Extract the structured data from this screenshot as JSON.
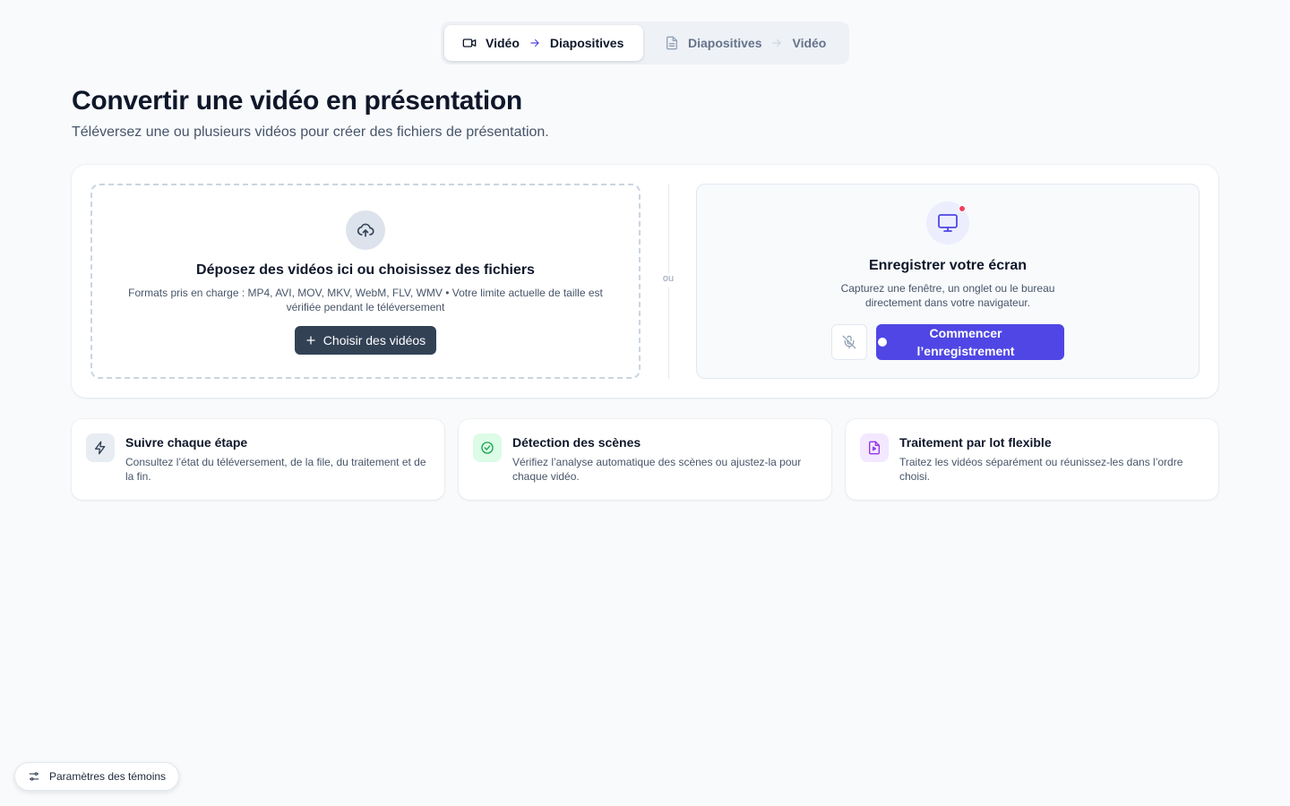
{
  "mode_switch": {
    "video_to_slides": {
      "from": "Vidéo",
      "to": "Diapositives",
      "icon": "video-camera-icon"
    },
    "slides_to_video": {
      "from": "Diapositives",
      "to": "Vidéo",
      "icon": "document-icon"
    }
  },
  "header": {
    "title": "Convertir une vidéo en présentation",
    "subtitle": "Téléversez une ou plusieurs vidéos pour créer des fichiers de présentation."
  },
  "dropzone": {
    "title": "Déposez des vidéos ici ou choisissez des fichiers",
    "formats": "Formats pris en charge : MP4, AVI, MOV, MKV, WebM, FLV, WMV • Votre limite actuelle de taille est vérifiée pendant le téléversement",
    "button_label": "Choisir des vidéos"
  },
  "divider": {
    "label": "ou"
  },
  "record": {
    "title": "Enregistrer votre écran",
    "description": "Capturez une fenêtre, un onglet ou le bureau directement dans votre navigateur.",
    "start_label": "Commencer l’enregistrement"
  },
  "features": [
    {
      "title": "Suivre chaque étape",
      "description": "Consultez l’état du téléversement, de la file, du traitement et de la fin.",
      "icon": "lightning-icon",
      "color": "#334155",
      "bg": "#e8ecf3"
    },
    {
      "title": "Détection des scènes",
      "description": "Vérifiez l’analyse automatique des scènes ou ajustez-la pour chaque vidéo.",
      "icon": "check-circle-icon",
      "color": "#16a34a",
      "bg": "#dcfce7"
    },
    {
      "title": "Traitement par lot flexible",
      "description": "Traitez les vidéos séparément ou réunissez-les dans l’ordre choisi.",
      "icon": "file-video-icon",
      "color": "#9333ea",
      "bg": "#f3e8ff"
    }
  ],
  "cookie": {
    "label": "Paramètres des témoins"
  },
  "colors": {
    "accent": "#4f46e5",
    "dark_button": "#334155",
    "record_dot": "#f43f5e"
  }
}
